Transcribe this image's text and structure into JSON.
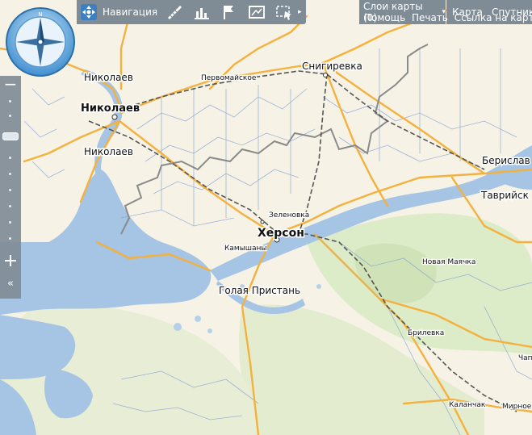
{
  "toolbar": {
    "navigation_label": "Навигация",
    "navigation_icon": "navigation-grid-icon",
    "tools": [
      "ruler-icon",
      "chart-icon",
      "flag-route-icon",
      "map-print-icon",
      "select-area-icon"
    ],
    "more_icon": "chevron-right-icon"
  },
  "top_right": {
    "layers_label": "Слои карты (0)",
    "map_label": "Карта",
    "satellite_label": "Спутник",
    "help_label": "Помощь",
    "print_label": "Печать",
    "link_label": "Ссылка на карту"
  },
  "zoom": {
    "minus": "−",
    "plus": "+",
    "collapse": "«"
  },
  "map": {
    "colors": {
      "sea": "#a6c4e4",
      "land": "#f6f3e6",
      "green": "#d6e8c4",
      "road_major": "#f4b13e",
      "border": "#8a8a8a",
      "rail": "#555555"
    },
    "cities": [
      {
        "name": "Николаев",
        "kind": "big"
      },
      {
        "name": "Николаев",
        "kind": "small"
      },
      {
        "name": "Николаев",
        "kind": "small"
      },
      {
        "name": "Херсон",
        "kind": "big"
      },
      {
        "name": "Снигиревка",
        "kind": "medium"
      },
      {
        "name": "Берислав",
        "kind": "medium"
      },
      {
        "name": "Таврийск",
        "kind": "medium"
      },
      {
        "name": "Голая Пристань",
        "kind": "medium"
      },
      {
        "name": "Первомайское",
        "kind": "small"
      },
      {
        "name": "Зеленовка",
        "kind": "small"
      },
      {
        "name": "Камышаны",
        "kind": "small"
      },
      {
        "name": "Новая Маячка",
        "kind": "small"
      },
      {
        "name": "Брилевка",
        "kind": "small"
      },
      {
        "name": "Каланчак",
        "kind": "small"
      },
      {
        "name": "Мирное",
        "kind": "small"
      },
      {
        "name": "Чап",
        "kind": "small"
      }
    ]
  }
}
